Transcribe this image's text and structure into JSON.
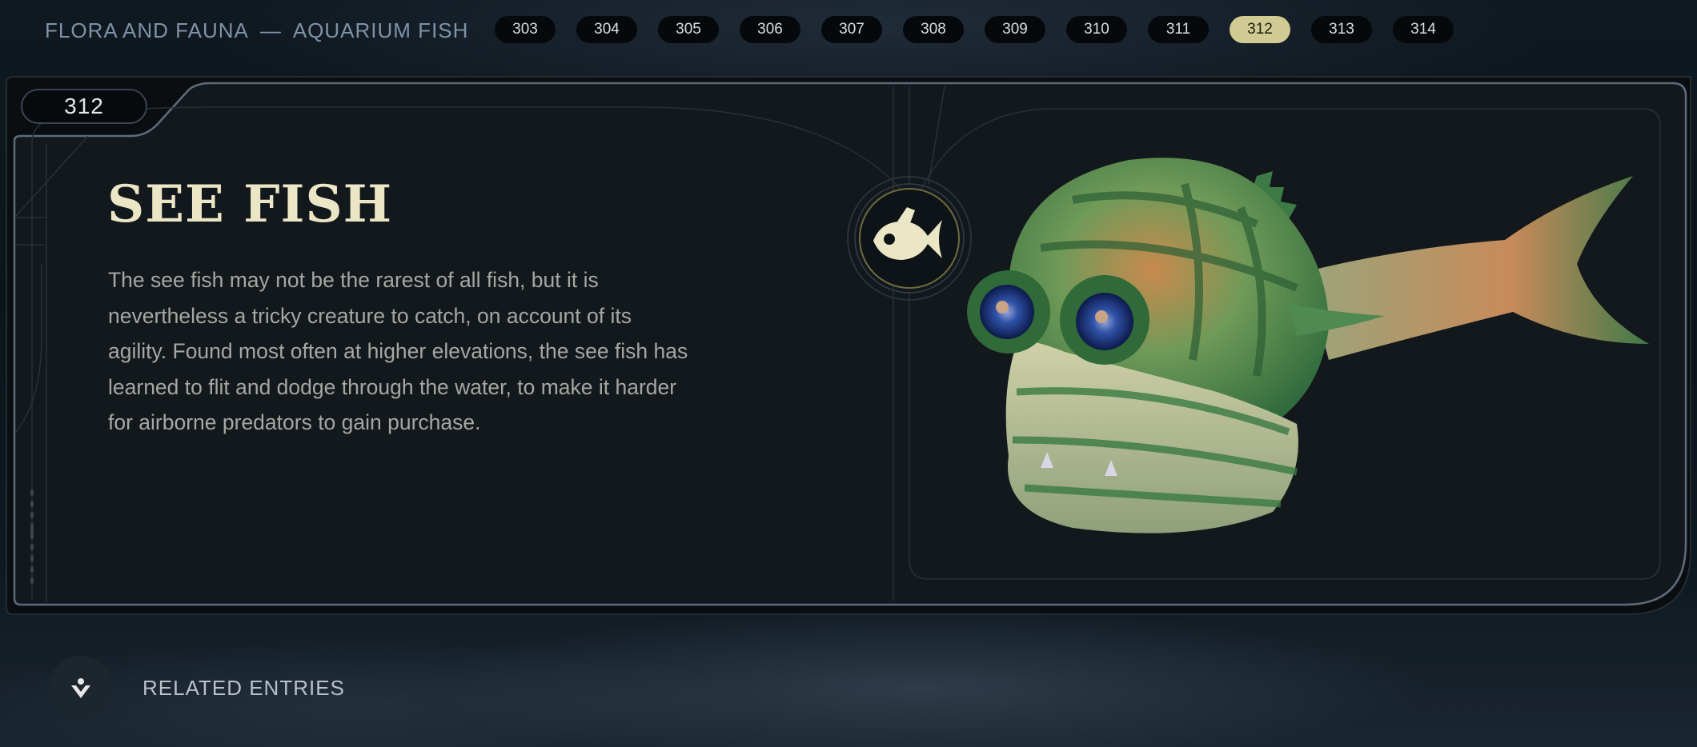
{
  "header": {
    "category": "FLORA AND FAUNA",
    "separator": "—",
    "subcategory": "AQUARIUM FISH",
    "entries": [
      "303",
      "304",
      "305",
      "306",
      "307",
      "308",
      "309",
      "310",
      "311",
      "312",
      "313",
      "314"
    ],
    "active_entry": "312"
  },
  "entry": {
    "number": "312",
    "title": "SEE FISH",
    "description": "The see fish may not be the rarest of all fish, but it is nevertheless a tricky creature to catch, on account of its agility. Found most often at higher elevations, the see fish has learned to flit and dodge through the water, to make it harder for airborne predators to gain purchase.",
    "icon": "fish-icon",
    "image": "see-fish-illustration"
  },
  "footer": {
    "related_label": "RELATED ENTRIES",
    "related_icon": "related-entries-icon"
  },
  "colors": {
    "accent": "#cfcb92",
    "title": "#ebe6c6",
    "panel_border": "#5d6c7c",
    "panel_bg": "#13181c"
  }
}
